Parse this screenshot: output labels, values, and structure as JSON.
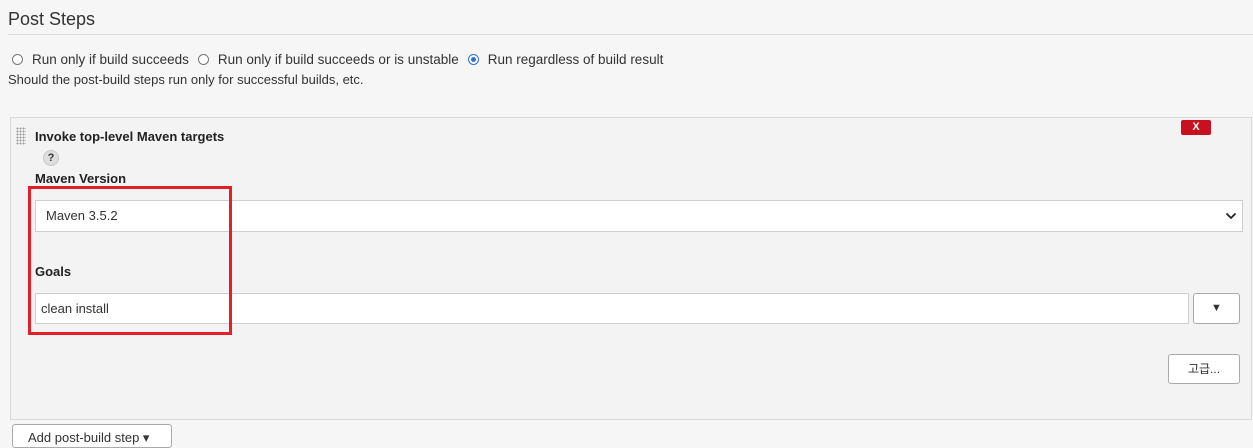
{
  "section": {
    "title": "Post Steps",
    "description": "Should the post-build steps run only for successful builds, etc."
  },
  "run_options": [
    {
      "label": "Run only if build succeeds",
      "selected": false
    },
    {
      "label": "Run only if build succeeds or is unstable",
      "selected": false
    },
    {
      "label": "Run regardless of build result",
      "selected": true
    }
  ],
  "step": {
    "title": "Invoke top-level Maven targets",
    "help_symbol": "?",
    "delete_label": "X",
    "maven_version": {
      "label": "Maven Version",
      "value": "Maven 3.5.2"
    },
    "goals": {
      "label": "Goals",
      "value": "clean install",
      "expand_symbol": "▼"
    },
    "advanced_label": "고급..."
  },
  "add_step_label": "Add post-build step ▾",
  "colors": {
    "highlight": "#e3202a",
    "delete": "#c9101e",
    "radio_selected": "#2b73d6"
  },
  "icons": [
    "drag-handle-icon",
    "help-icon",
    "chevron-down-icon"
  ]
}
